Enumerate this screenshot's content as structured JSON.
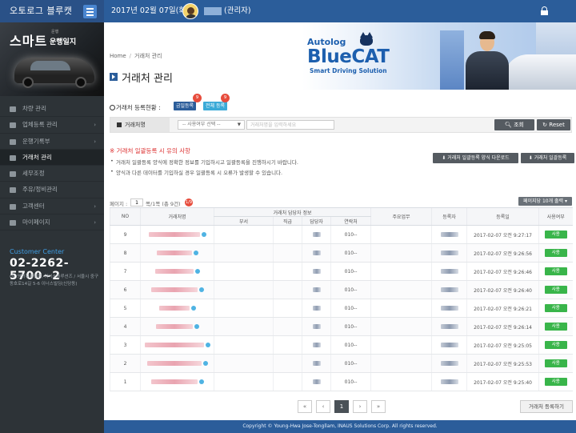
{
  "header": {
    "brand": "오토로그 블루캣",
    "date": "2017년 02월 07일(화)",
    "role": "(관리자)"
  },
  "sidebar": {
    "banner_small": "운행",
    "banner_title": "스마트",
    "banner_sub": "운행일지",
    "items": [
      {
        "label": "차량 관리",
        "active": false,
        "chevron": ""
      },
      {
        "label": "업체등록 관리",
        "active": false,
        "chevron": "›"
      },
      {
        "label": "운행기록부",
        "active": false,
        "chevron": "›"
      },
      {
        "label": "거래처 관리",
        "active": true,
        "chevron": ""
      },
      {
        "label": "세무조정",
        "active": false,
        "chevron": ""
      },
      {
        "label": "주유/정비관리",
        "active": false,
        "chevron": ""
      },
      {
        "label": "고객센터",
        "active": false,
        "chevron": "›"
      },
      {
        "label": "마이페이지",
        "active": false,
        "chevron": "›"
      }
    ],
    "customer_center_label": "Customer Center",
    "customer_center_phone": "02-2262-5700~2",
    "address": "(주)영화유세정판, 이너스솔루션즈 / 서울시 중구 동호로14길 5-6 이너스빌딩(신당동)"
  },
  "breadcrumb": {
    "home": "Home",
    "sep": "/",
    "current": "거래처 관리"
  },
  "page_title": "거래처 관리",
  "logo": {
    "autolog": "Autolog",
    "bluecat": "BlueCAT",
    "tagline": "Smart Driving Solution"
  },
  "status": {
    "label": "거래처 등록현황 :",
    "today_label": "금일등록",
    "today_count": "9",
    "total_label": "전체 등록",
    "total_count": "9"
  },
  "search": {
    "label": "거래처명",
    "select_value": "-- 사용여부 선택 --",
    "input_placeholder": "거래처명을 입력하세요",
    "search_button": "조회",
    "reset_button": "Reset"
  },
  "notice": {
    "title": "※ 거래처 일괄등록 시 유의 사항",
    "lines": [
      "거래처 일괄등록 양식에 정확한 정보를 기입하시고 일괄등록을 진행하시기 바랍니다.",
      "양식과 다른 데이터를 기입하실 경우 일괄등록 시 오류가 발생할 수 있습니다."
    ],
    "sample_button": "거래처 일괄등록 양식 다운로드",
    "bulk_button": "거래처 일괄등록"
  },
  "pagination_info": {
    "page_label": "페이지 :",
    "page_value": "1",
    "rest": "쪽/1쪽 (총 9건)",
    "badge": "1/9",
    "per_page": "페이지당 10개 출력 ▾"
  },
  "table": {
    "headers": {
      "no": "NO",
      "name": "거래처명",
      "contact_group": "거래처 담당자 정보",
      "dept": "부서",
      "position": "직급",
      "manager": "담당자",
      "phone": "연락처",
      "main_task": "주요업무",
      "registrant": "등록자",
      "reg_date": "등록일",
      "use": "사용여부"
    },
    "rows": [
      {
        "no": "9",
        "phone": "010--",
        "date": "2017-02-07 오전 9:27:17",
        "use": "사용"
      },
      {
        "no": "8",
        "phone": "010--",
        "date": "2017-02-07 오전 9:26:56",
        "use": "사용"
      },
      {
        "no": "7",
        "phone": "010--",
        "date": "2017-02-07 오전 9:26:46",
        "use": "사용"
      },
      {
        "no": "6",
        "phone": "010--",
        "date": "2017-02-07 오전 9:26:40",
        "use": "사용"
      },
      {
        "no": "5",
        "phone": "010--",
        "date": "2017-02-07 오전 9:26:21",
        "use": "사용"
      },
      {
        "no": "4",
        "phone": "010--",
        "date": "2017-02-07 오전 9:26:14",
        "use": "사용"
      },
      {
        "no": "3",
        "phone": "010--",
        "date": "2017-02-07 오전 9:25:05",
        "use": "사용"
      },
      {
        "no": "2",
        "phone": "010--",
        "date": "2017-02-07 오전 9:25:53",
        "use": "사용"
      },
      {
        "no": "1",
        "phone": "010--",
        "date": "2017-02-07 오전 9:25:40",
        "use": "사용"
      }
    ]
  },
  "pager": {
    "first": "«",
    "prev": "‹",
    "current": "1",
    "next": "›",
    "last": "»"
  },
  "register_button": "거래처 등록하기",
  "footer": "Copyright © Young-Hwa Jose-Tongllam, INAUS Solutions Corp. All rights reserved.",
  "colors": {
    "primary": "#2b5d9a",
    "sidebar": "#2d3337",
    "use_badge": "#39b54a",
    "badge_red": "#e74c3c"
  }
}
